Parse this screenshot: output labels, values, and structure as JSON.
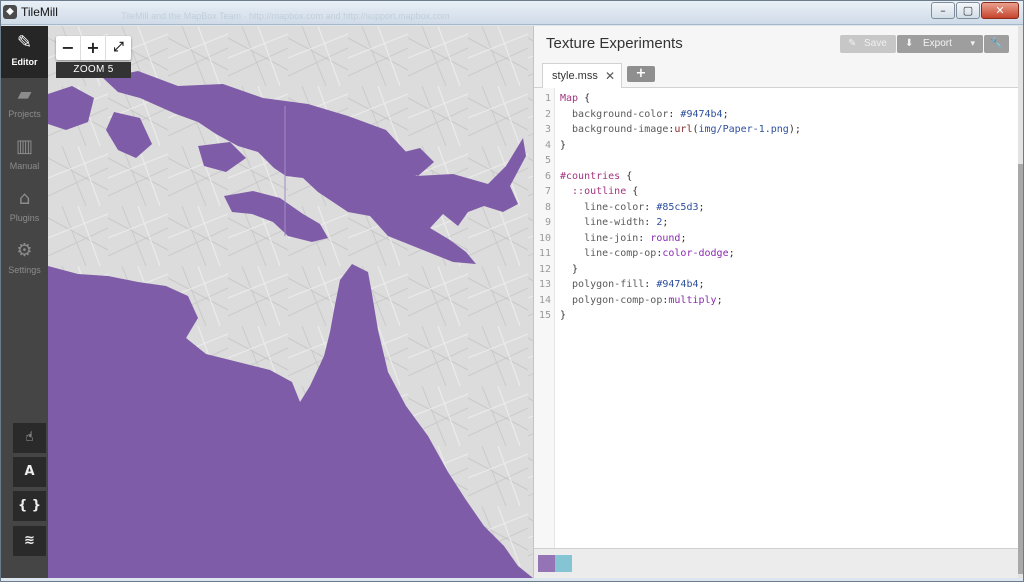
{
  "window": {
    "title": "TileMill",
    "app_icon_glyph": "◆",
    "ghost_text": "TileMill and the MapBox Team · http://mapbox.com and http://support.mapbox.com"
  },
  "window_controls": {
    "minimize": "–",
    "maximize": "▢",
    "close": "✕"
  },
  "sidebar": {
    "items": [
      {
        "label": "Editor",
        "icon": "pencil-icon",
        "glyph": "✎",
        "active": true
      },
      {
        "label": "Projects",
        "icon": "folder-icon",
        "glyph": "▰",
        "active": false
      },
      {
        "label": "Manual",
        "icon": "book-icon",
        "glyph": "▥",
        "active": false
      },
      {
        "label": "Plugins",
        "icon": "plug-icon",
        "glyph": "⌂",
        "active": false
      },
      {
        "label": "Settings",
        "icon": "gear-icon",
        "glyph": "⚙",
        "active": false
      }
    ],
    "tools": [
      {
        "name": "hand-tool",
        "icon": "hand-icon",
        "glyph": "☝"
      },
      {
        "name": "font-tool",
        "icon": "font-icon",
        "glyph": "A"
      },
      {
        "name": "braces-tool",
        "icon": "braces-icon",
        "glyph": "{ }"
      },
      {
        "name": "layers-tool",
        "icon": "layers-icon",
        "glyph": "≋"
      }
    ]
  },
  "map": {
    "zoom_out": "−",
    "zoom_in": "+",
    "fullscreen": "⤢",
    "zoom_level": "ZOOM 5",
    "land_color": "#d8d8d8",
    "fill_color": "#7f5ca8"
  },
  "panel": {
    "project_title": "Texture Experiments",
    "save_label": "Save",
    "save_glyph": "✎",
    "export_label": "Export",
    "export_glyph": "⬇",
    "export_caret": "▾",
    "settings_glyph": "🔧",
    "tab_label": "style.mss",
    "tab_close": "✕",
    "add_tab": "+"
  },
  "editor": {
    "lines": [
      {
        "n": "1",
        "parts": [
          [
            "sel",
            "Map"
          ],
          [
            "plain",
            " {"
          ]
        ]
      },
      {
        "n": "2",
        "parts": [
          [
            "prop",
            "  background-color"
          ],
          [
            "plain",
            ": "
          ],
          [
            "col",
            "#9474b4"
          ],
          [
            "plain",
            ";"
          ]
        ]
      },
      {
        "n": "3",
        "parts": [
          [
            "prop",
            "  background-image"
          ],
          [
            "plain",
            ":"
          ],
          [
            "fn",
            "url"
          ],
          [
            "plain",
            "("
          ],
          [
            "col",
            "img/Paper-1.png"
          ],
          [
            "plain",
            ");"
          ]
        ]
      },
      {
        "n": "4",
        "parts": [
          [
            "plain",
            "}"
          ]
        ]
      },
      {
        "n": "5",
        "parts": []
      },
      {
        "n": "6",
        "parts": [
          [
            "sel",
            "#countries"
          ],
          [
            "plain",
            " {"
          ]
        ]
      },
      {
        "n": "7",
        "parts": [
          [
            "sel",
            "  ::outline"
          ],
          [
            "plain",
            " {"
          ]
        ]
      },
      {
        "n": "8",
        "parts": [
          [
            "prop",
            "    line-color"
          ],
          [
            "plain",
            ": "
          ],
          [
            "col",
            "#85c5d3"
          ],
          [
            "plain",
            ";"
          ]
        ]
      },
      {
        "n": "9",
        "parts": [
          [
            "prop",
            "    line-width"
          ],
          [
            "plain",
            ": "
          ],
          [
            "col",
            "2"
          ],
          [
            "plain",
            ";"
          ]
        ]
      },
      {
        "n": "10",
        "parts": [
          [
            "prop",
            "    line-join"
          ],
          [
            "plain",
            ": "
          ],
          [
            "kw",
            "round"
          ],
          [
            "plain",
            ";"
          ]
        ]
      },
      {
        "n": "11",
        "parts": [
          [
            "prop",
            "    line-comp-op"
          ],
          [
            "plain",
            ":"
          ],
          [
            "kw",
            "color-dodge"
          ],
          [
            "plain",
            ";"
          ]
        ]
      },
      {
        "n": "12",
        "parts": [
          [
            "plain",
            "  }"
          ]
        ]
      },
      {
        "n": "13",
        "parts": [
          [
            "prop",
            "  polygon-fill"
          ],
          [
            "plain",
            ": "
          ],
          [
            "col",
            "#9474b4"
          ],
          [
            "plain",
            ";"
          ]
        ]
      },
      {
        "n": "14",
        "parts": [
          [
            "prop",
            "  polygon-comp-op"
          ],
          [
            "plain",
            ":"
          ],
          [
            "kw",
            "multiply"
          ],
          [
            "plain",
            ";"
          ]
        ]
      },
      {
        "n": "15",
        "parts": [
          [
            "plain",
            "}"
          ]
        ]
      }
    ]
  },
  "swatches": [
    "#9474b4",
    "#85c5d3"
  ]
}
